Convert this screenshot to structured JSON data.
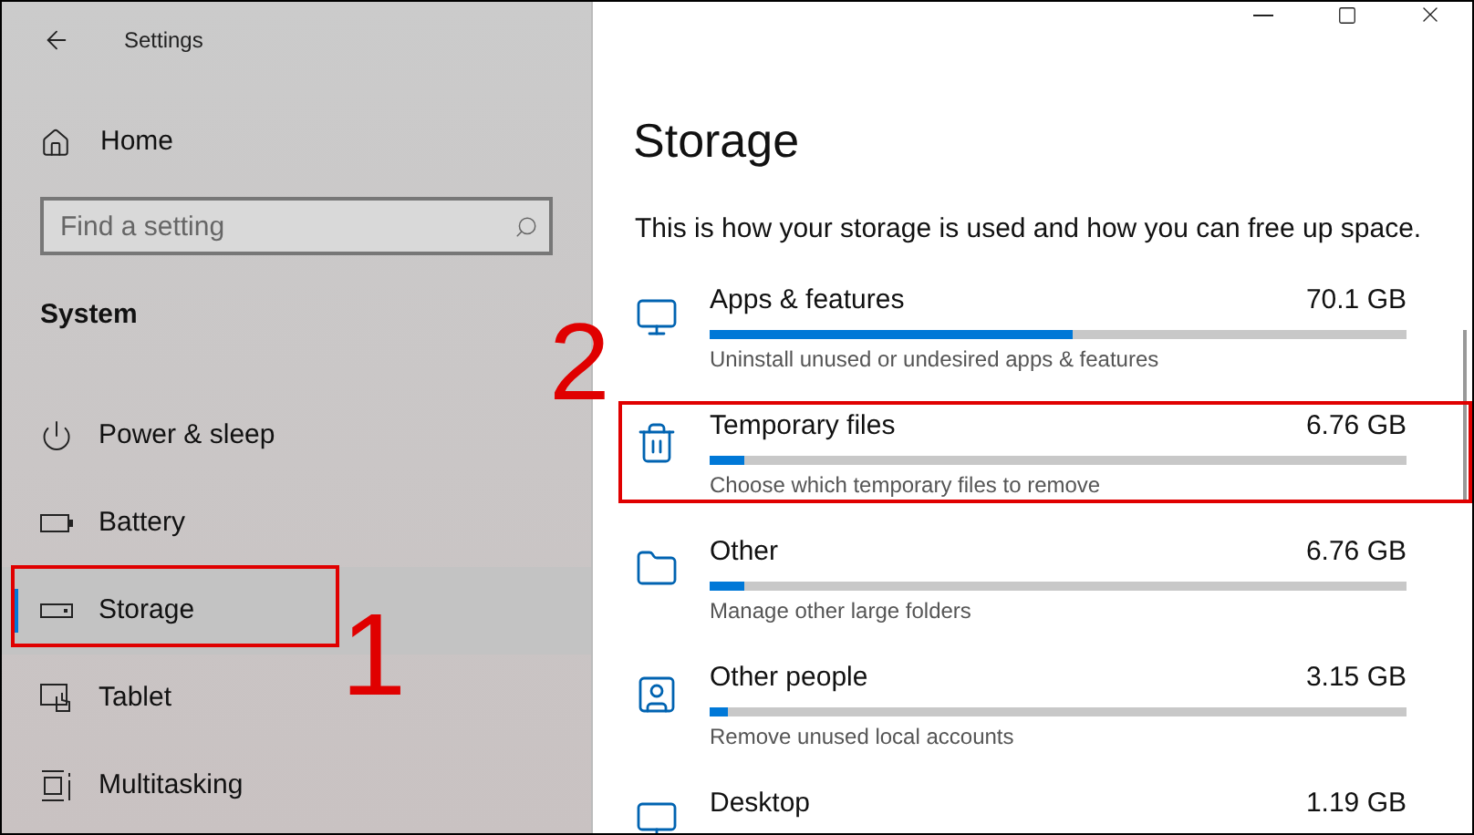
{
  "window": {
    "title": "Settings"
  },
  "sidebar": {
    "home": "Home",
    "search": {
      "placeholder": "Find a setting"
    },
    "section": "System",
    "items": [
      {
        "label": "Power & sleep",
        "selected": false
      },
      {
        "label": "Battery",
        "selected": false
      },
      {
        "label": "Storage",
        "selected": true
      },
      {
        "label": "Tablet",
        "selected": false
      },
      {
        "label": "Multitasking",
        "selected": false
      }
    ]
  },
  "main": {
    "title": "Storage",
    "description": "This is how your storage is used and how you can free up space.",
    "categories": [
      {
        "name": "Apps & features",
        "size": "70.1 GB",
        "level": 0.52,
        "hint": "Uninstall unused or undesired apps & features"
      },
      {
        "name": "Temporary files",
        "size": "6.76 GB",
        "level": 0.05,
        "hint": "Choose which temporary files to remove"
      },
      {
        "name": "Other",
        "size": "6.76 GB",
        "level": 0.05,
        "hint": "Manage other large folders"
      },
      {
        "name": "Other people",
        "size": "3.15 GB",
        "level": 0.025,
        "hint": "Remove unused local accounts"
      },
      {
        "name": "Desktop",
        "size": "1.19 GB"
      }
    ]
  },
  "annotations": [
    {
      "label": "1"
    },
    {
      "label": "2"
    }
  ]
}
